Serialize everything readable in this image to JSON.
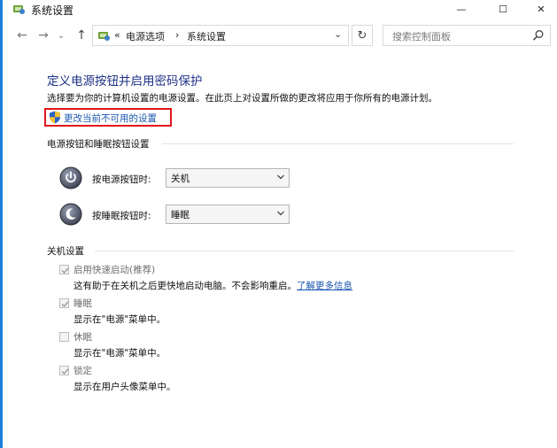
{
  "window": {
    "title": "系统设置",
    "minimize_glyph": "—",
    "maximize_glyph": "☐",
    "close_glyph": "✕"
  },
  "nav": {
    "back_glyph": "←",
    "forward_glyph": "→",
    "recent_glyph": "⌄",
    "up_glyph": "↑"
  },
  "address": {
    "prefix": "«",
    "segment1": "电源选项",
    "separator": "›",
    "segment2": "系统设置",
    "dropdown_glyph": "⌄",
    "refresh_glyph": "↻"
  },
  "search": {
    "placeholder": "搜索控制面板"
  },
  "main": {
    "heading": "定义电源按钮并启用密码保护",
    "description": "选择要为你的计算机设置的电源设置。在此页上对设置所做的更改将应用于你所有的电源计划。",
    "change_link": "更改当前不可用的设置"
  },
  "power_section": {
    "title": "电源按钮和睡眠按钮设置",
    "rows": [
      {
        "label": "按电源按钮时:",
        "value": "关机"
      },
      {
        "label": "按睡眠按钮时:",
        "value": "睡眠"
      }
    ]
  },
  "shutdown_section": {
    "title": "关机设置",
    "items": [
      {
        "label": "启用快速启动(推荐)",
        "desc": "这有助于在关机之后更快地启动电脑。不会影响重启。",
        "link": "了解更多信息",
        "checked": true
      },
      {
        "label": "睡眠",
        "desc": "显示在\"电源\"菜单中。",
        "checked": true
      },
      {
        "label": "休眠",
        "desc": "显示在\"电源\"菜单中。",
        "checked": false
      },
      {
        "label": "锁定",
        "desc": "显示在用户头像菜单中。",
        "checked": true
      }
    ]
  },
  "colors": {
    "accent_bar": "#1f7fd8",
    "heading": "#1e3287",
    "link": "#1a56b0",
    "highlight_border": "#e0151b"
  }
}
